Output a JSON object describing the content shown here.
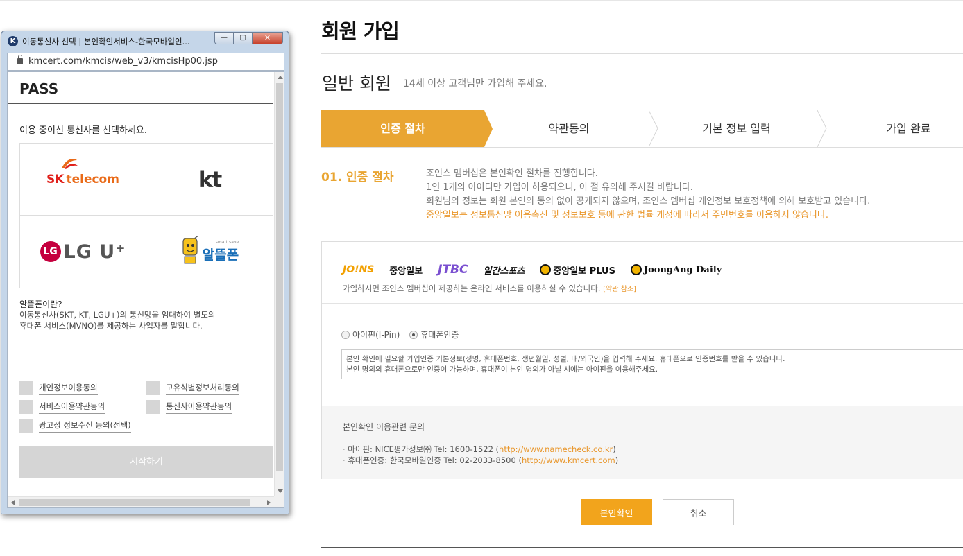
{
  "page": {
    "title": "회원 가입",
    "member_type": "일반 회원",
    "member_desc": "14세 이상 고객님만 가입해 주세요."
  },
  "steps": [
    {
      "label": "인증 절차",
      "active": true
    },
    {
      "label": "약관동의",
      "active": false
    },
    {
      "label": "기본 정보 입력",
      "active": false
    },
    {
      "label": "가입 완료",
      "active": false
    }
  ],
  "section": {
    "label": "01. 인증 절차",
    "lines": [
      "조인스 멤버십은 본인확인 절차를 진행합니다.",
      "1인 1개의 아이디만 가입이 허용되오니, 이 점 유의해 주시길 바랍니다.",
      "회원님의 정보는 회원 본인의 동의 없이 공개되지 않으며, 조인스 멤버십 개인정보 보호정책에 의해 보호받고 있습니다."
    ],
    "warning": "중앙일보는 정보통신망 이용촉진 및 정보보호 등에 관한 법률 개정에 따라서 주민번호를 이용하지 않습니다."
  },
  "brands": [
    "JO!NS",
    "중앙일보",
    "JTBC",
    "일간스포츠",
    "중앙일보 PLUS",
    "JoongAng Daily"
  ],
  "brand_desc": {
    "text": "가입하시면 조인스 멤버십이 제공하는 온라인 서비스를 이용하실 수 있습니다.",
    "terms_link": "[약관 참조]"
  },
  "auth": {
    "options": [
      {
        "label": "아이핀(I-Pin)",
        "selected": false
      },
      {
        "label": "휴대폰인증",
        "selected": true
      }
    ],
    "info_lines": [
      "본인 확인에 필요할 가입인증 기본정보(성명, 휴대폰번호, 생년월일, 성별, 내/외국인)을 입력해 주세요. 휴대폰으로 인증번호를 받을 수 있습니다.",
      "본인 명의의 휴대폰으로만 인증이 가능하며, 휴대폰이 본인 명의가 아닐 시에는 아이핀을 이용해주세요."
    ]
  },
  "inquiry": {
    "title": "본인확인 이용관련 문의",
    "ipin_text": "· 아이핀: NICE평가정보㈜ Tel: 1600-1522 (",
    "ipin_url": "http://www.namecheck.co.kr",
    "phone_text": "· 휴대폰인증: 한국모바일인증 Tel: 02-2033-8500 (",
    "phone_url": "http://www.kmcert.com",
    "close_paren": ")"
  },
  "buttons": {
    "confirm": "본인확인",
    "cancel": "취소"
  },
  "popup": {
    "window_title": "이동통신사 선택 | 본인확인서비스-한국모바일인...",
    "app_icon": "K",
    "url": "kmcert.com/kmcis/web_v3/kmcisHp00.jsp",
    "logo": "PASS",
    "prompt": "이용 중이신 통신사를 선택하세요.",
    "carriers": {
      "skt_sk": "SK",
      "skt_tel": "telecom",
      "kt": "kt",
      "lgu_circle": "LG",
      "lgu_text": "LG U⁺",
      "mvno": "알뜰폰",
      "mvno_small": "smart save"
    },
    "mvno_question": "알뜰폰이란?",
    "mvno_desc": [
      "이동통신사(SKT, KT, LGU+)의 통신망을 임대하여 별도의",
      "휴대폰 서비스(MVNO)를 제공하는 사업자를 말합니다."
    ],
    "agreements": [
      "개인정보이용동의",
      "고유식별정보처리동의",
      "서비스이용약관동의",
      "통신사이용약관동의",
      "광고성 정보수신 동의(선택)"
    ],
    "start_button": "시작하기",
    "window_buttons": {
      "min": "—",
      "max": "▢",
      "close": "✕"
    }
  },
  "colors": {
    "accent": "#e9a532",
    "button": "#f2a41c",
    "link": "#e9962a",
    "skt_red": "#e0201b",
    "lgu": "#c5003e",
    "mvno_blue": "#1a6fb8"
  },
  "icons": [
    "lock-icon",
    "app-icon",
    "minimize-icon",
    "maximize-icon",
    "close-icon",
    "radio-icon",
    "checkbox-icon",
    "scroll-arrow-icon"
  ]
}
